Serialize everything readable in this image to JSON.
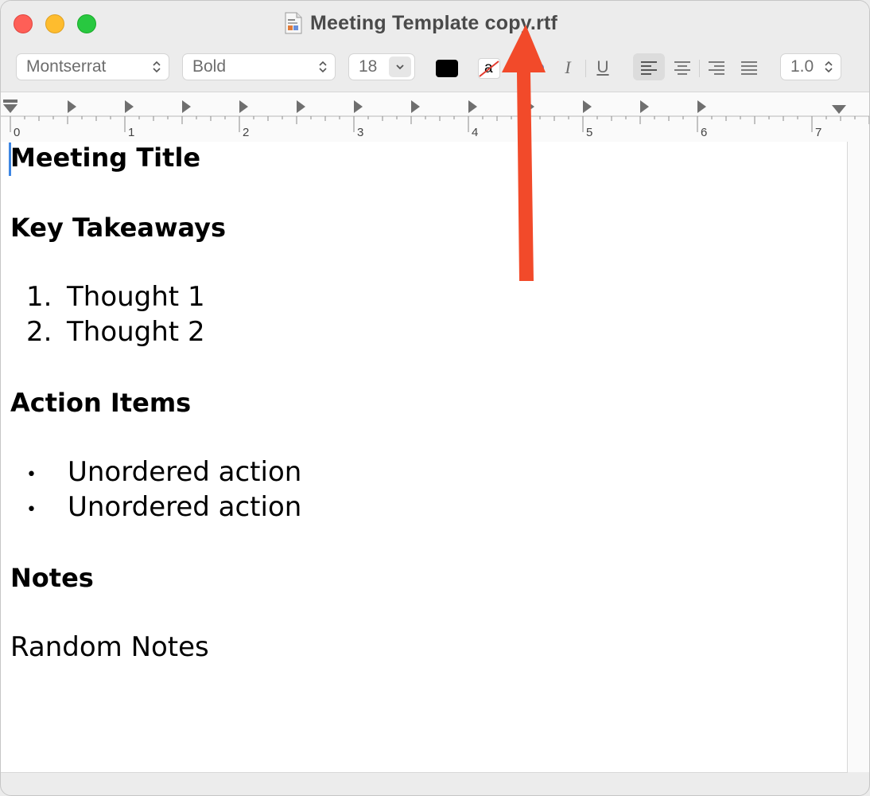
{
  "window": {
    "title": "Meeting Template copy.rtf"
  },
  "toolbar": {
    "font_family": "Montserrat",
    "font_style": "Bold",
    "font_size": "18",
    "text_color": "#000000",
    "highlight_glyph": "a",
    "italic_label": "I",
    "underline_label": "U",
    "line_spacing": "1.0"
  },
  "ruler": {
    "labels": [
      "0",
      "1",
      "2",
      "3",
      "4",
      "5",
      "6",
      "7"
    ]
  },
  "document": {
    "heading_title": "Meeting Title",
    "heading_takeaways": "Key Takeaways",
    "takeaways": [
      {
        "marker": "1.",
        "text": "Thought 1"
      },
      {
        "marker": "2.",
        "text": "Thought 2"
      }
    ],
    "heading_actions": "Action Items",
    "actions": [
      {
        "marker": "•",
        "text": "Unordered action"
      },
      {
        "marker": "•",
        "text": "Unordered action"
      }
    ],
    "heading_notes": "Notes",
    "notes_text": "Random Notes"
  },
  "colors": {
    "annotation_arrow": "#f24a2a",
    "caret": "#3d86e3"
  }
}
